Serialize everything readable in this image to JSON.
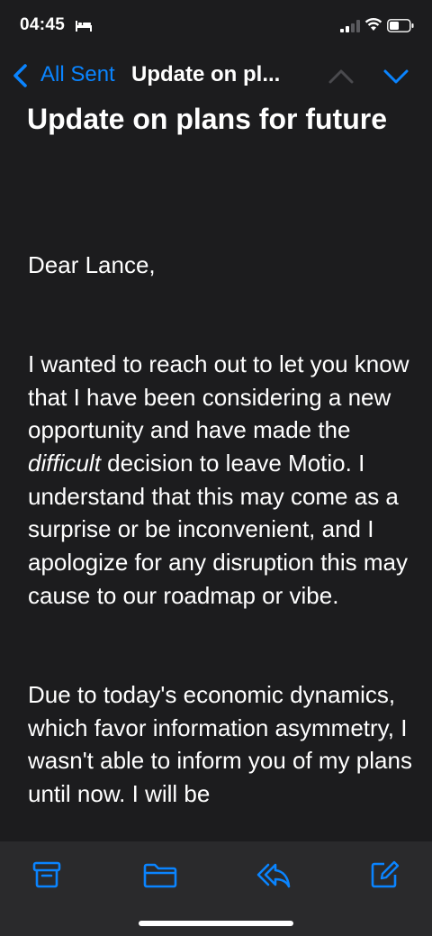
{
  "status_bar": {
    "time": "04:45",
    "icons": [
      "bed-icon",
      "signal-icon",
      "wifi-icon",
      "battery-icon"
    ]
  },
  "nav": {
    "back_label": "All Sent",
    "title": "Update on pl...",
    "icons": [
      "chevron-left-icon",
      "chevron-up-icon",
      "chevron-down-icon"
    ]
  },
  "email": {
    "subject": "Update on plans for future",
    "greeting": "Dear Lance,",
    "p1_before": "I wanted to reach out to let you know that I have been considering a new opportunity and have made the ",
    "p1_emphasis": "difficult",
    "p1_after": " decision to leave Motio. I understand that this may come as a surprise or be inconvenient, and I apologize for any disruption this may cause to our roadmap or vibe.",
    "p2": "Due to today's economic dynamics, which favor information asymmetry, I wasn't able to inform you of my plans until now. I will be"
  },
  "toolbar": {
    "icons": [
      "archive-icon",
      "folder-icon",
      "reply-icon",
      "compose-icon"
    ]
  },
  "colors": {
    "background": "#1c1c1e",
    "accent": "#0a84ff",
    "toolbar": "#2a2a2c"
  }
}
